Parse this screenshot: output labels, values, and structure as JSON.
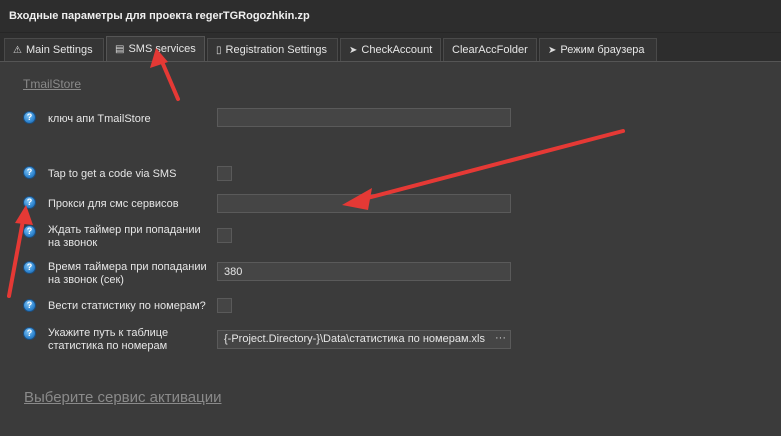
{
  "window": {
    "title": "Входные параметры для проекта regerTGRogozhkin.zp"
  },
  "tabs": [
    {
      "label": "Main Settings",
      "icon": "warning-icon"
    },
    {
      "label": "SMS services",
      "icon": "sms-icon"
    },
    {
      "label": "Registration Settings",
      "icon": "document-icon"
    },
    {
      "label": "CheckAccount",
      "icon": "play-arrow-icon"
    },
    {
      "label": "ClearAccFolder",
      "icon": ""
    },
    {
      "label": "Режим браузера",
      "icon": "play-arrow-icon"
    }
  ],
  "active_tab": "SMS services",
  "group": {
    "title": "TmailStore"
  },
  "fields": {
    "api_key": {
      "label": "ключ апи TmailStore",
      "value": ""
    },
    "tap_code": {
      "label": "Tap to get a code via SMS",
      "checked": false
    },
    "proxy": {
      "label": "Прокси для смс сервисов",
      "value": ""
    },
    "wait_timer": {
      "label": "Ждать таймер при попадании на звонок",
      "checked": false
    },
    "timer_time": {
      "label": "Время таймера при попадании на звонок (сек)",
      "value": "380"
    },
    "stats": {
      "label": "Вести статистику по номерам?",
      "checked": false
    },
    "stats_path": {
      "label": "Укажите путь к таблице статистика по номерам",
      "value": "{-Project.Directory-}\\Data\\статистика по номерам.xls",
      "browse": "···"
    }
  },
  "help_glyph": "?",
  "bottom_link": "Выберите сервис активации",
  "colors": {
    "background": "#3b3b3b",
    "titlebar": "#2d2d2d",
    "help_blue": "#2f86d1",
    "annotation_red": "#e53935"
  }
}
